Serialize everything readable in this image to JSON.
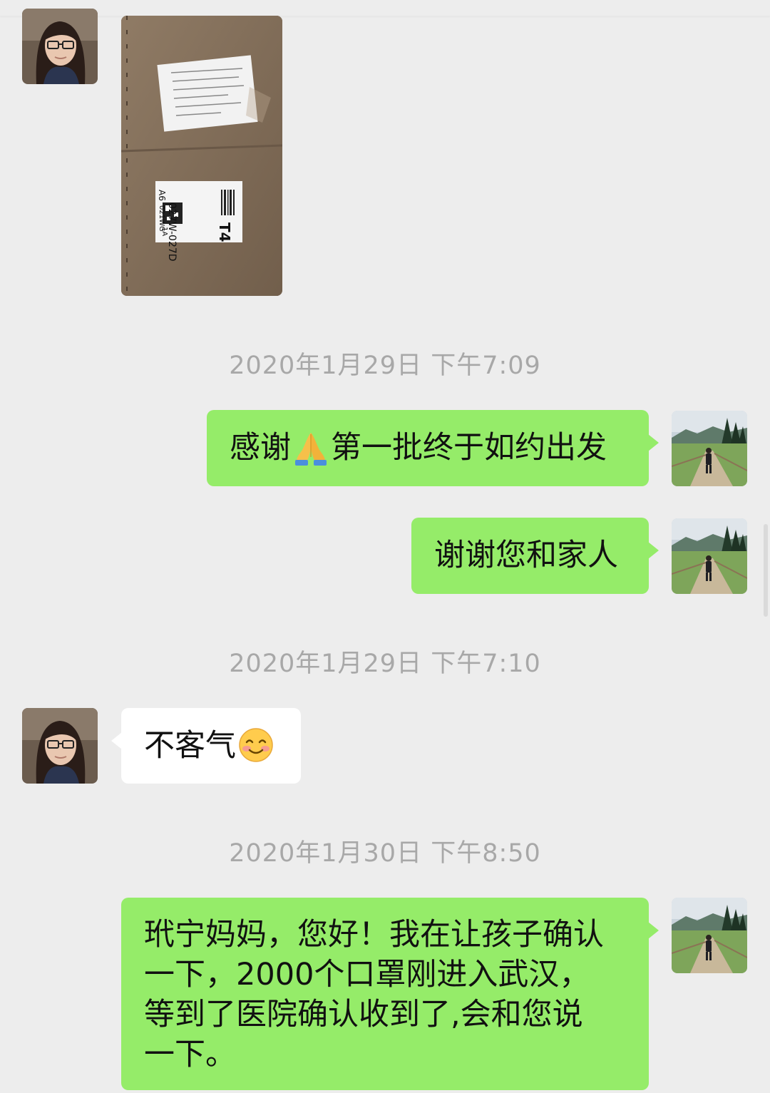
{
  "chat": {
    "messages": [
      {
        "type": "timestamp",
        "text": "2020年1月29日 下午7:09"
      },
      {
        "type": "outgoing",
        "parts": [
          "感谢",
          "第一批终于如约出发"
        ],
        "emoji": "folded-hands"
      },
      {
        "type": "outgoing",
        "text": "谢谢您和家人"
      },
      {
        "type": "timestamp",
        "text": "2020年1月29日 下午7:10"
      },
      {
        "type": "incoming",
        "text": "不客气",
        "emoji": "smiling-face"
      },
      {
        "type": "timestamp",
        "text": "2020年1月30日 下午8:50"
      },
      {
        "type": "outgoing",
        "lines": [
          "玳宁妈妈，您好！我在让孩子确认",
          "一下，2000个口罩刚进入武汉，",
          "等到了医院确认收到了,会和您说",
          "一下。"
        ]
      }
    ],
    "package_labels": {
      "label_code": "027W-027D",
      "label_a6": "A6",
      "label_021": "021WG",
      "label_1a": "1A",
      "label_t4": "T4"
    }
  },
  "colors": {
    "background": "#ededed",
    "outgoing_bubble": "#95ec69",
    "incoming_bubble": "#ffffff",
    "timestamp_text": "#a8a8a8"
  },
  "icons": {
    "contact_avatar": "woman-with-glasses-avatar",
    "self_avatar": "meadow-hiker-avatar",
    "emoji_1": "folded-hands-emoji",
    "emoji_2": "smiling-face-emoji"
  }
}
